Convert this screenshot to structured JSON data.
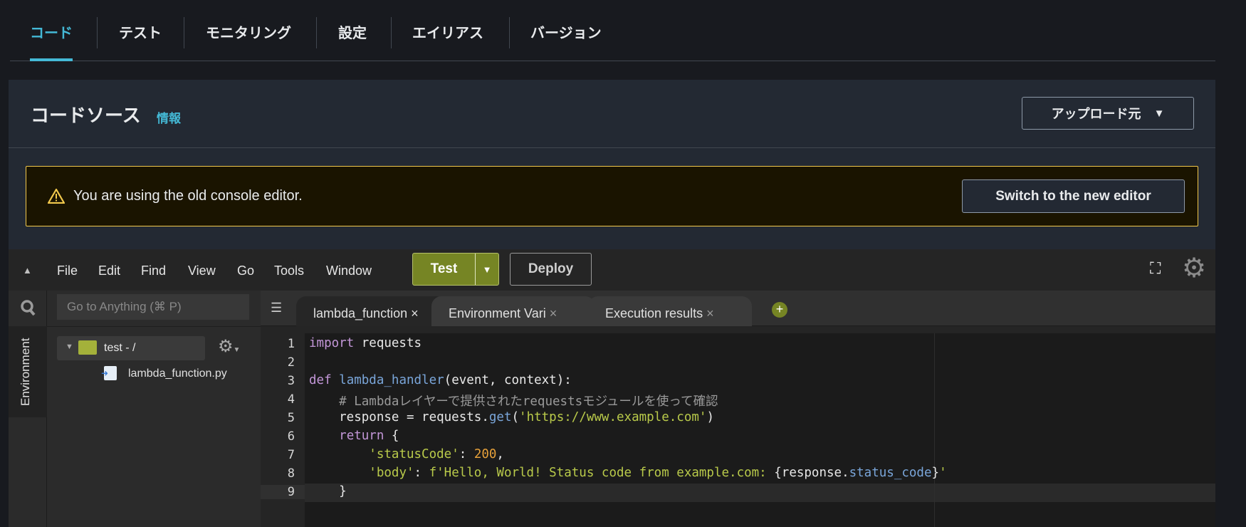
{
  "top_tabs": [
    "コード",
    "テスト",
    "モニタリング",
    "設定",
    "エイリアス",
    "バージョン"
  ],
  "panel": {
    "title": "コードソース",
    "info_link": "情報",
    "upload_button": "アップロード元"
  },
  "alert": {
    "message": "You are using the old console editor.",
    "button": "Switch to the new editor"
  },
  "editor": {
    "menu": [
      "File",
      "Edit",
      "Find",
      "View",
      "Go",
      "Tools",
      "Window"
    ],
    "test_button": "Test",
    "deploy_button": "Deploy",
    "search_placeholder": "Go to Anything (⌘ P)",
    "side_tab": "Environment",
    "tree": {
      "folder": "test - /",
      "file": "lambda_function.py"
    },
    "tabs": [
      "lambda_function",
      "Environment Vari",
      "Execution results"
    ],
    "line_numbers": [
      "1",
      "2",
      "3",
      "4",
      "5",
      "6",
      "7",
      "8",
      "9"
    ],
    "code": {
      "l1a": "import",
      "l1b": " requests",
      "l3a": "def ",
      "l3b": "lambda_handler",
      "l3c": "(event, context):",
      "l4": "    # Lambdaレイヤーで提供されたrequestsモジュールを使って確認",
      "l5a": "    response = requests.",
      "l5b": "get",
      "l5c": "(",
      "l5d": "'https://www.example.com'",
      "l5e": ")",
      "l6a": "    ",
      "l6b": "return",
      "l6c": " {",
      "l7a": "        ",
      "l7b": "'statusCode'",
      "l7c": ": ",
      "l7d": "200",
      "l7e": ",",
      "l8a": "        ",
      "l8b": "'body'",
      "l8c": ": ",
      "l8d": "f'Hello, World! Status code from example.com: ",
      "l8e": "{response.",
      "l8f": "status_code",
      "l8g": "}",
      "l8h": "'",
      "l9": "    }"
    }
  }
}
